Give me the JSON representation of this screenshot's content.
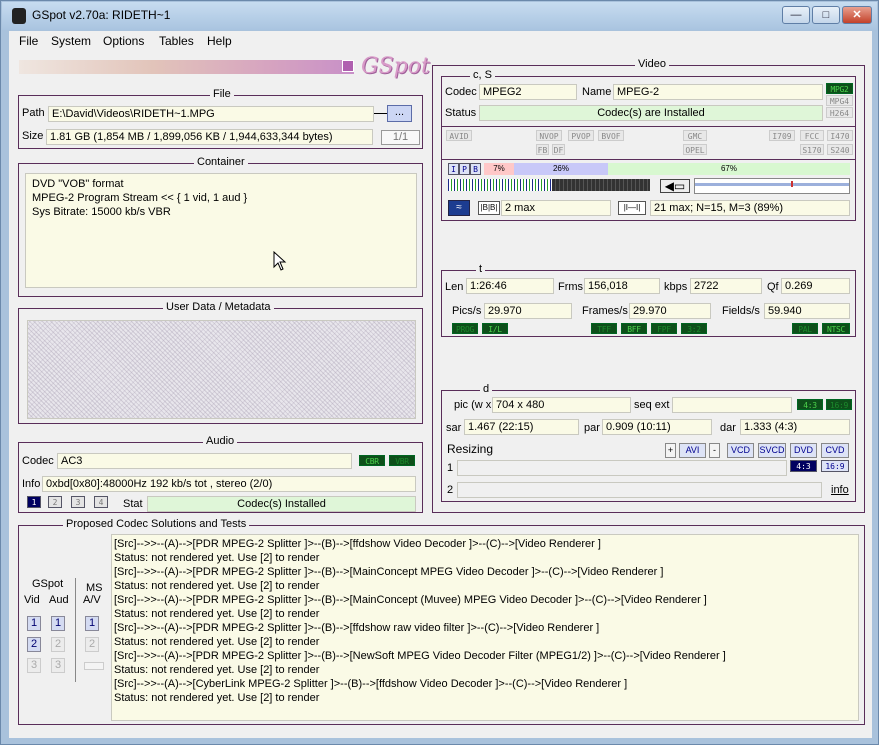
{
  "window": {
    "title": "GSpot v2.70a: RIDETH~1"
  },
  "menu": [
    "File",
    "System",
    "Options",
    "Tables",
    "Help"
  ],
  "logo_text": "GSpot",
  "file": {
    "group_title": "File",
    "path_label": "Path",
    "path_value": "E:\\David\\Videos\\RIDETH~1.MPG",
    "browse_label": "...",
    "size_label": "Size",
    "size_value": "1.81 GB (1,854 MB / 1,899,056 KB / 1,944,633,344 bytes)",
    "page": "1/1"
  },
  "container": {
    "group_title": "Container",
    "text": "DVD \"VOB\" format\nMPEG-2 Program Stream << { 1 vid, 1 aud }\nSys Bitrate: 15000 kb/s VBR"
  },
  "userdata": {
    "group_title": "User Data / Metadata"
  },
  "audio": {
    "group_title": "Audio",
    "codec_label": "Codec",
    "codec_value": "AC3",
    "badges": [
      "CBR",
      "VBR"
    ],
    "info_label": "Info",
    "info_value": "0xbd[0x80]:48000Hz  192 kb/s tot , stereo (2/0)",
    "stream_buttons": [
      "1",
      "2",
      "3",
      "4"
    ],
    "stat_label": "Stat",
    "stat_value": "Codec(s) Installed"
  },
  "video": {
    "group_title": "Video",
    "cs_title": "c, S",
    "codec_label": "Codec",
    "codec_value": "MPEG2",
    "name_label": "Name",
    "name_value": "MPEG-2",
    "codec_badges": [
      "MPG2",
      "MPG4",
      "H264"
    ],
    "status_label": "Status",
    "status_value": "Codec(s) are Installed",
    "flags": [
      "AVID",
      "NVOP",
      "PVOP",
      "BVOF",
      "FB",
      "DF",
      "GMC",
      "OPEL",
      "I709",
      "FCC",
      "I470",
      "S170",
      "S240"
    ],
    "ipb": [
      "I",
      "P",
      "B"
    ],
    "pct_i": "7%",
    "pct_p": "26%",
    "pct_b": "67%",
    "bmax": "2 max",
    "gop": "21 max; N=15, M=3 (89%)",
    "t_title": "t",
    "len_label": "Len",
    "len_value": "1:26:46",
    "frms_label": "Frms",
    "frms_value": "156,018",
    "kbps_label": "kbps",
    "kbps_value": "2722",
    "qf_label": "Qf",
    "qf_value": "0.269",
    "pics_label": "Pics/s",
    "pics_value": "29.970",
    "frames_label": "Frames/s",
    "frames_value": "29.970",
    "fields_label": "Fields/s",
    "fields_value": "59.940",
    "t_badges": [
      "PROG",
      "I/L",
      "TFF",
      "BFF",
      "FPF",
      "3:2",
      "PAL",
      "NTSC"
    ],
    "d_title": "d",
    "pic_label": "pic (w x h)",
    "pic_value": "704 x 480",
    "seqext_label": "seq ext",
    "ar_badges": [
      "4:3",
      "16:9"
    ],
    "sar_label": "sar",
    "sar_value": "1.467 (22:15)",
    "par_label": "par",
    "par_value": "0.909 (10:11)",
    "dar_label": "dar",
    "dar_value": "1.333 (4:3)",
    "resizing_label": "Resizing",
    "resize_buttons": [
      "+",
      "AVI",
      "-",
      "VCD",
      "SVCD",
      "DVD",
      "CVD"
    ],
    "row1": "1",
    "row2": "2",
    "ar2_badges": [
      "4:3",
      "16:9"
    ],
    "info_link": "info"
  },
  "solutions": {
    "group_title": "Proposed Codec Solutions and Tests",
    "gspot_label": "GSpot",
    "vid_label": "Vid",
    "aud_label": "Aud",
    "ms_label": "MS",
    "av_label": "A/V",
    "lines": [
      "[Src]-->>--(A)-->[PDR MPEG-2 Splitter ]>--(B)-->[ffdshow Video Decoder ]>--(C)-->[Video Renderer ]",
      "Status: not rendered yet. Use [2] to render",
      "[Src]-->>--(A)-->[PDR MPEG-2 Splitter ]>--(B)-->[MainConcept MPEG Video Decoder ]>--(C)-->[Video Renderer ]",
      "Status: not rendered yet. Use [2] to render",
      "[Src]-->>--(A)-->[PDR MPEG-2 Splitter ]>--(B)-->[MainConcept (Muvee) MPEG Video Decoder ]>--(C)-->[Video Renderer ]",
      "Status: not rendered yet. Use [2] to render",
      "[Src]-->>--(A)-->[PDR MPEG-2 Splitter ]>--(B)-->[ffdshow raw video filter ]>--(C)-->[Video Renderer ]",
      "Status: not rendered yet. Use [2] to render",
      "[Src]-->>--(A)-->[PDR MPEG-2 Splitter ]>--(B)-->[NewSoft MPEG Video Decoder Filter (MPEG1/2) ]>--(C)-->[Video Renderer ]",
      "Status: not rendered yet. Use [2] to render",
      "[Src]-->>--(A)-->[CyberLink MPEG-2 Splitter ]>--(B)-->[ffdshow Video Decoder ]>--(C)-->[Video Renderer ]",
      "Status: not rendered yet. Use [2] to render"
    ]
  }
}
